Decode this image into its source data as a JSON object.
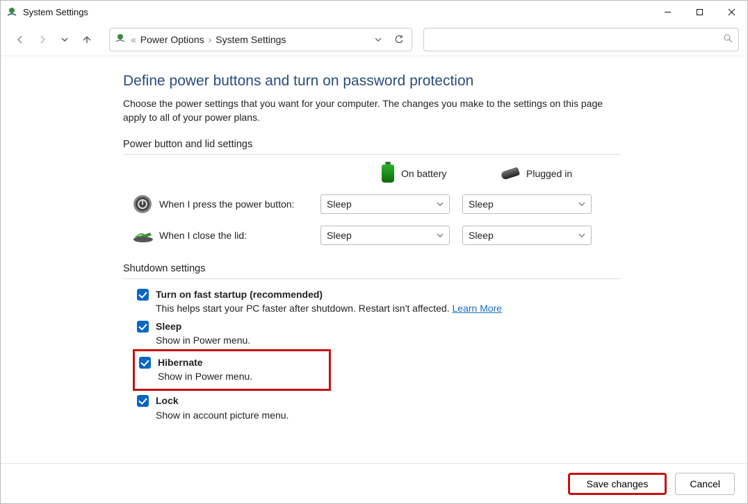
{
  "window": {
    "title": "System Settings"
  },
  "breadcrumb": {
    "parent": "Power Options",
    "current": "System Settings"
  },
  "page": {
    "heading": "Define power buttons and turn on password protection",
    "description": "Choose the power settings that you want for your computer. The changes you make to the settings on this page apply to all of your power plans."
  },
  "sections": {
    "power_header": "Power button and lid settings",
    "shutdown_header": "Shutdown settings"
  },
  "columns": {
    "on_battery": "On battery",
    "plugged_in": "Plugged in"
  },
  "rows": {
    "power_button": {
      "label": "When I press the power button:",
      "battery": "Sleep",
      "plugged": "Sleep"
    },
    "lid": {
      "label": "When I close the lid:",
      "battery": "Sleep",
      "plugged": "Sleep"
    }
  },
  "shutdown": {
    "fast": {
      "title": "Turn on fast startup (recommended)",
      "desc": "This helps start your PC faster after shutdown. Restart isn't affected.",
      "learn": "Learn More"
    },
    "sleep": {
      "title": "Sleep",
      "desc": "Show in Power menu."
    },
    "hibernate": {
      "title": "Hibernate",
      "desc": "Show in Power menu."
    },
    "lock": {
      "title": "Lock",
      "desc": "Show in account picture menu."
    }
  },
  "buttons": {
    "save": "Save changes",
    "cancel": "Cancel"
  }
}
